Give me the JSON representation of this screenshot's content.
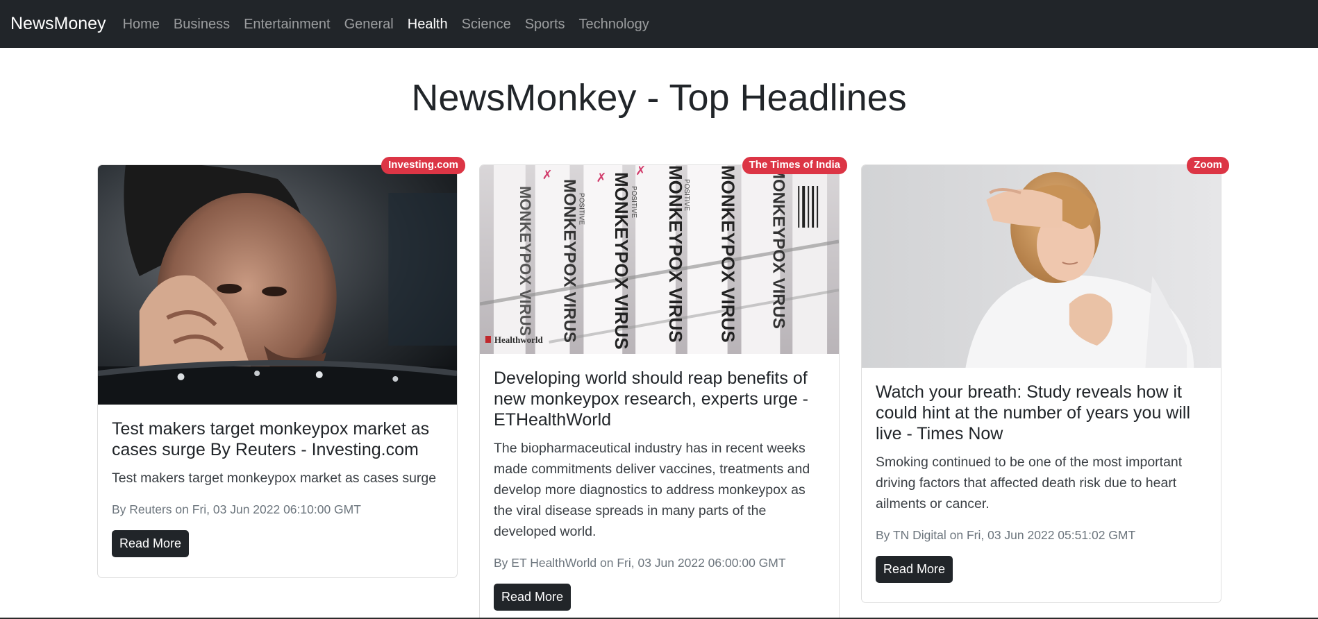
{
  "navbar": {
    "brand": "NewsMoney",
    "links": [
      {
        "label": "Home",
        "active": false
      },
      {
        "label": "Business",
        "active": false
      },
      {
        "label": "Entertainment",
        "active": false
      },
      {
        "label": "General",
        "active": false
      },
      {
        "label": "Health",
        "active": true
      },
      {
        "label": "Science",
        "active": false
      },
      {
        "label": "Sports",
        "active": false
      },
      {
        "label": "Technology",
        "active": false
      }
    ]
  },
  "page": {
    "title": "NewsMonkey - Top Headlines"
  },
  "articles": [
    {
      "source": "Investing.com",
      "title": "Test makers target monkeypox market as cases surge By Reuters - Investing.com",
      "description": "Test makers target monkeypox market as cases surge",
      "meta": "By Reuters on Fri, 03 Jun 2022 06:10:00 GMT",
      "button": "Read More"
    },
    {
      "source": "The Times of India",
      "title": "Developing world should reap benefits of new monkeypox research, experts urge - ETHealthWorld",
      "description": "The biopharmaceutical industry has in recent weeks made commitments deliver vaccines, treatments and develop more diagnostics to address monkeypox as the viral disease spreads in many parts of the developed world.",
      "meta": "By ET HealthWorld on Fri, 03 Jun 2022 06:00:00 GMT",
      "button": "Read More",
      "image_text": {
        "tube_label": "MONKEYPOX VIRUS",
        "tube_small": "POSITIVE",
        "watermark": "Healthworld"
      }
    },
    {
      "source": "Zoom",
      "title": "Watch your breath: Study reveals how it could hint at the number of years you will live - Times Now",
      "description": "Smoking continued to be one of the most important driving factors that affected death risk due to heart ailments or cancer.",
      "meta": "By TN Digital on Fri, 03 Jun 2022 05:51:02 GMT",
      "button": "Read More"
    }
  ],
  "colors": {
    "navbar_bg": "#212529",
    "badge_bg": "#dc3545",
    "button_bg": "#212529",
    "meta_text": "#6c757d"
  }
}
